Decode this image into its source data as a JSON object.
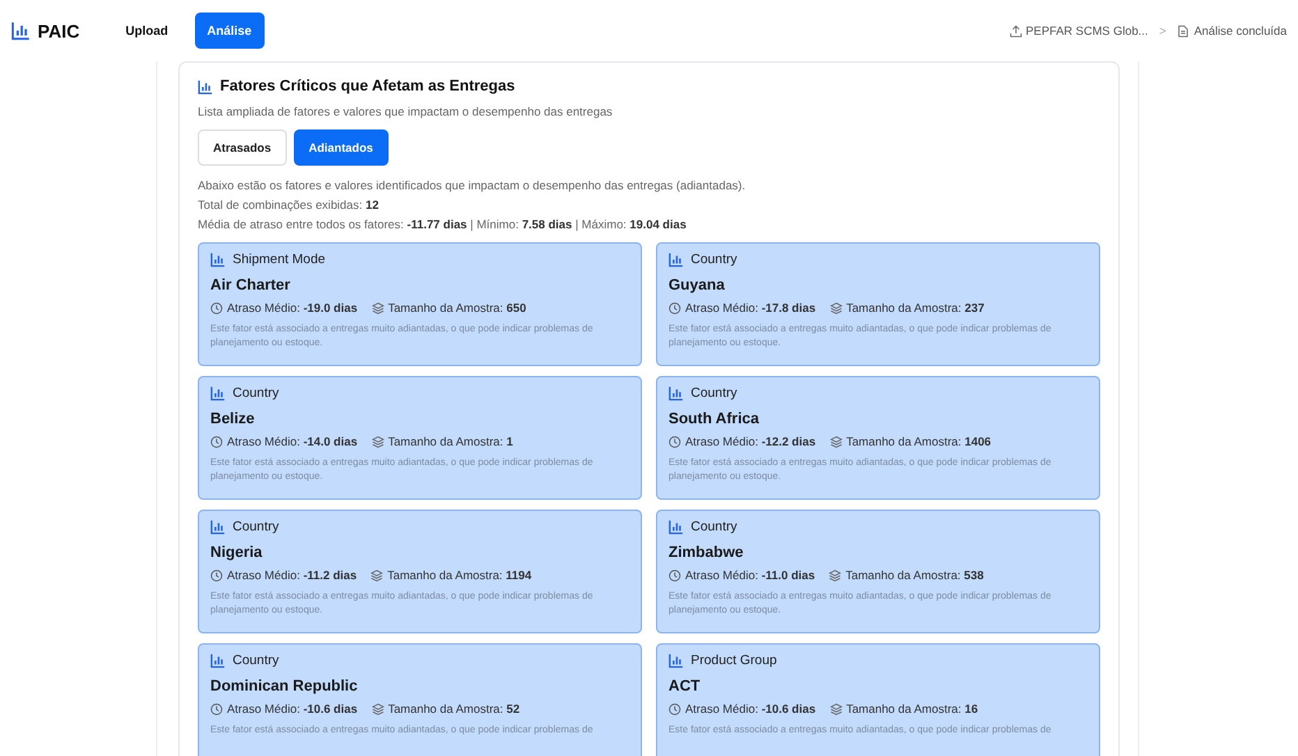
{
  "app": {
    "name": "PAIC"
  },
  "nav_tabs": [
    {
      "label": "Upload",
      "selected": false
    },
    {
      "label": "Análise",
      "selected": true
    }
  ],
  "breadcrumb": {
    "file": "PEPFAR SCMS Glob...",
    "separator": ">",
    "status": "Análise concluída"
  },
  "section": {
    "title": "Fatores Críticos que Afetam as Entregas",
    "subtitle": "Lista ampliada de fatores e valores que impactam o desempenho das entregas",
    "toggles": [
      {
        "label": "Atrasados",
        "selected": false
      },
      {
        "label": "Adiantados",
        "selected": true
      }
    ],
    "intro": "Abaixo estão os fatores e valores identificados que impactam o desempenho das entregas (adiantadas).",
    "total": "Total de combinações exibidas: **12**",
    "stats": "Média de atraso entre todos os fatores: **-11.77 dias** | Mínimo: **7.58 dias** | Máximo: **19.04 dias**"
  },
  "factors": [
    {
      "category": "Shipment Mode",
      "value": "Air Charter",
      "delay": "Atraso Médio: **-19.0 dias**",
      "sample": "Tamanho da Amostra: **650**",
      "note": "Este fator está associado a entregas muito adiantadas, o que pode indicar problemas de planejamento ou estoque."
    },
    {
      "category": "Country",
      "value": "Guyana",
      "delay": "Atraso Médio: **-17.8 dias**",
      "sample": "Tamanho da Amostra: **237**",
      "note": "Este fator está associado a entregas muito adiantadas, o que pode indicar problemas de planejamento ou estoque."
    },
    {
      "category": "Country",
      "value": "Belize",
      "delay": "Atraso Médio: **-14.0 dias**",
      "sample": "Tamanho da Amostra: **1**",
      "note": "Este fator está associado a entregas muito adiantadas, o que pode indicar problemas de planejamento ou estoque."
    },
    {
      "category": "Country",
      "value": "South Africa",
      "delay": "Atraso Médio: **-12.2 dias**",
      "sample": "Tamanho da Amostra: **1406**",
      "note": "Este fator está associado a entregas muito adiantadas, o que pode indicar problemas de planejamento ou estoque."
    },
    {
      "category": "Country",
      "value": "Nigeria",
      "delay": "Atraso Médio: **-11.2 dias**",
      "sample": "Tamanho da Amostra: **1194**",
      "note": "Este fator está associado a entregas muito adiantadas, o que pode indicar problemas de planejamento ou estoque."
    },
    {
      "category": "Country",
      "value": "Zimbabwe",
      "delay": "Atraso Médio: **-11.0 dias**",
      "sample": "Tamanho da Amostra: **538**",
      "note": "Este fator está associado a entregas muito adiantadas, o que pode indicar problemas de planejamento ou estoque."
    },
    {
      "category": "Country",
      "value": "Dominican Republic",
      "delay": "Atraso Médio: **-10.6 dias**",
      "sample": "Tamanho da Amostra: **52**",
      "note": "Este fator está associado a entregas muito adiantadas, o que pode indicar problemas de"
    },
    {
      "category": "Product Group",
      "value": "ACT",
      "delay": "Atraso Médio: **-10.6 dias**",
      "sample": "Tamanho da Amostra: **16**",
      "note": "Este fator está associado a entregas muito adiantadas, o que pode indicar problemas de"
    }
  ]
}
